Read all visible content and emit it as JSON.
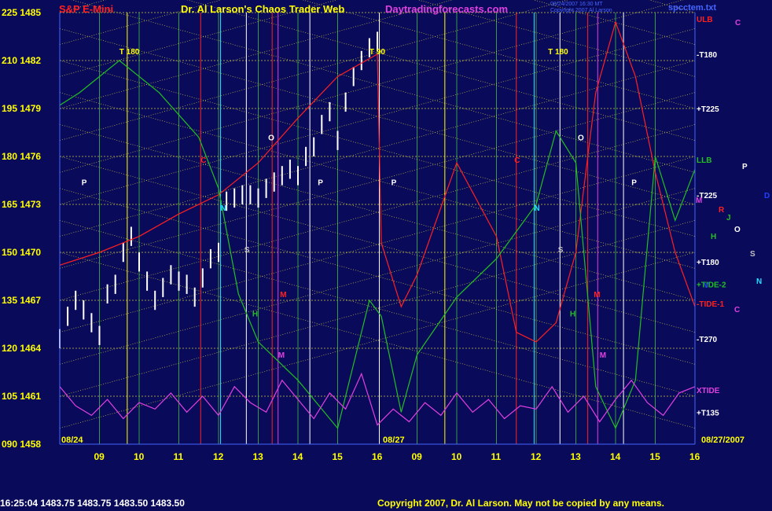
{
  "header": {
    "left_title": "S&P E-Mini",
    "center_title": "Dr. Al Larson's Chaos Trader Web",
    "site": "Daytradingforecasts.com",
    "stamp_line1": "08/24/2007 16:30 MT",
    "stamp_line2": "Copyright 2007 Al Larson",
    "file": "spcctem.txt"
  },
  "footer": {
    "quote": "16:25:04  1483.75 1483.75 1483.50 1483.50",
    "copyright": "Copyright 2007, Dr. Al Larson. May not be copied by any means."
  },
  "colors": {
    "background": "#0a0a5a",
    "axis_text": "#ffff00",
    "price_bars": "#ffffff",
    "red_line": "#ff2020",
    "green_line": "#20c020",
    "xtide": "#e040e0"
  },
  "chart_data": {
    "type": "line",
    "title": "S&P E-Mini",
    "x_labels": [
      "09",
      "10",
      "11",
      "12",
      "13",
      "14",
      "15",
      "16",
      "09",
      "10",
      "11",
      "12",
      "13",
      "14",
      "15",
      "16"
    ],
    "date_labels": [
      "08/24",
      "08/27",
      "08/27/2007"
    ],
    "y_axis_left": [
      {
        "idx": "225",
        "price": "1485",
        "v": 225
      },
      {
        "idx": "210",
        "price": "1482",
        "v": 210
      },
      {
        "idx": "195",
        "price": "1479",
        "v": 195
      },
      {
        "idx": "180",
        "price": "1476",
        "v": 180
      },
      {
        "idx": "165",
        "price": "1473",
        "v": 165
      },
      {
        "idx": "150",
        "price": "1470",
        "v": 150
      },
      {
        "idx": "135",
        "price": "1467",
        "v": 135
      },
      {
        "idx": "120",
        "price": "1464",
        "v": 120
      },
      {
        "idx": "105",
        "price": "1461",
        "v": 105
      },
      {
        "idx": "090",
        "price": "1458",
        "v": 90
      }
    ],
    "ylim": [
      90,
      225
    ],
    "xlim": [
      0,
      16
    ],
    "right_labels": [
      {
        "text": "ULB",
        "v": 223,
        "color": "#ff2020"
      },
      {
        "text": "-T180",
        "v": 212,
        "color": "#ffffff"
      },
      {
        "text": "+T225",
        "v": 195,
        "color": "#ffffff"
      },
      {
        "text": "LLB",
        "v": 179,
        "color": "#20c020"
      },
      {
        "text": "-T225",
        "v": 168,
        "color": "#ffffff"
      },
      {
        "text": "+T180",
        "v": 147,
        "color": "#ffffff"
      },
      {
        "text": "+TIDE-2",
        "v": 140,
        "color": "#20c020"
      },
      {
        "text": "-TIDE-1",
        "v": 134,
        "color": "#ff2020"
      },
      {
        "text": "-T270",
        "v": 123,
        "color": "#ffffff"
      },
      {
        "text": "XTIDE",
        "v": 107,
        "color": "#e040e0"
      },
      {
        "text": "+T135",
        "v": 100,
        "color": "#ffffff"
      }
    ],
    "legend_letters": [
      {
        "text": "C",
        "color": "#e040e0"
      },
      {
        "text": "P",
        "color": "#ffffff"
      },
      {
        "text": "D",
        "color": "#2040ff"
      },
      {
        "text": "M",
        "color": "#e040e0"
      },
      {
        "text": "R",
        "color": "#ff2020"
      },
      {
        "text": "J",
        "color": "#20c020"
      },
      {
        "text": "H",
        "color": "#20c020"
      },
      {
        "text": "O",
        "color": "#ffffff"
      },
      {
        "text": "S",
        "color": "#c0c0c0"
      },
      {
        "text": "V",
        "color": "#2040ff"
      },
      {
        "text": "N",
        "color": "#20e0ff"
      },
      {
        "text": "C",
        "color": "#e040e0"
      }
    ],
    "annotations": [
      {
        "text": "T 180",
        "x": 1.5,
        "v": 212,
        "color": "#ffff00"
      },
      {
        "text": "T 90",
        "x": 7.8,
        "v": 212,
        "color": "#ffff00"
      },
      {
        "text": "T 180",
        "x": 12.3,
        "v": 212,
        "color": "#ffff00"
      },
      {
        "text": "P",
        "x": 0.55,
        "v": 171,
        "color": "#ffffff"
      },
      {
        "text": "P",
        "x": 6.5,
        "v": 171,
        "color": "#ffffff"
      },
      {
        "text": "P",
        "x": 8.35,
        "v": 171,
        "color": "#ffffff"
      },
      {
        "text": "P",
        "x": 14.4,
        "v": 171,
        "color": "#ffffff"
      },
      {
        "text": "O",
        "x": 5.25,
        "v": 185,
        "color": "#ffffff"
      },
      {
        "text": "O",
        "x": 13.05,
        "v": 185,
        "color": "#ffffff"
      },
      {
        "text": "C",
        "x": 3.55,
        "v": 178,
        "color": "#ff2020"
      },
      {
        "text": "C",
        "x": 11.45,
        "v": 178,
        "color": "#ff2020"
      },
      {
        "text": "N",
        "x": 4.05,
        "v": 163,
        "color": "#20e0ff"
      },
      {
        "text": "N",
        "x": 11.95,
        "v": 163,
        "color": "#20e0ff"
      },
      {
        "text": "S",
        "x": 4.65,
        "v": 150,
        "color": "#c0c0c0"
      },
      {
        "text": "S",
        "x": 12.55,
        "v": 150,
        "color": "#c0c0c0"
      },
      {
        "text": "M",
        "x": 5.55,
        "v": 136,
        "color": "#ff2020"
      },
      {
        "text": "M",
        "x": 13.45,
        "v": 136,
        "color": "#ff2020"
      },
      {
        "text": "H",
        "x": 4.85,
        "v": 130,
        "color": "#20c020"
      },
      {
        "text": "H",
        "x": 12.85,
        "v": 130,
        "color": "#20c020"
      },
      {
        "text": "M",
        "x": 5.5,
        "v": 117,
        "color": "#e040e0"
      },
      {
        "text": "M",
        "x": 13.6,
        "v": 117,
        "color": "#e040e0"
      }
    ],
    "series": [
      {
        "name": "price",
        "type": "bars",
        "x": [
          0.0,
          0.2,
          0.4,
          0.6,
          0.8,
          1.0,
          1.2,
          1.4,
          1.6,
          1.8,
          2.0,
          2.2,
          2.4,
          2.6,
          2.8,
          3.0,
          3.2,
          3.4,
          3.6,
          3.8,
          4.0,
          4.2,
          4.4,
          4.6,
          4.8,
          5.0,
          5.2,
          5.4,
          5.6,
          5.8,
          6.0,
          6.2,
          6.4,
          6.6,
          6.8,
          7.0,
          7.2,
          7.4,
          7.6,
          7.8,
          8.0
        ],
        "y": [
          123,
          130,
          135,
          132,
          128,
          124,
          137,
          140,
          150,
          155,
          147,
          141,
          135,
          139,
          143,
          141,
          140,
          136,
          142,
          148,
          150,
          166,
          167,
          168,
          168,
          167,
          170,
          172,
          174,
          176,
          174,
          180,
          183,
          190,
          194,
          185,
          197,
          205,
          210,
          214,
          216
        ]
      },
      {
        "name": "red",
        "type": "line",
        "x": [
          0,
          1,
          2,
          3,
          4,
          5,
          6,
          7,
          8,
          8.1,
          8.6,
          9,
          10,
          11,
          11.5,
          12,
          12.5,
          13,
          13.5,
          14,
          14.5,
          15,
          15.5,
          16
        ],
        "y": [
          146,
          150,
          155,
          162,
          168,
          178,
          192,
          205,
          212,
          153,
          133,
          143,
          178,
          155,
          125,
          122,
          128,
          150,
          200,
          222,
          205,
          175,
          150,
          133
        ]
      },
      {
        "name": "green",
        "type": "line",
        "x": [
          0,
          0.5,
          1.5,
          2.5,
          3.5,
          4,
          4.5,
          5,
          6,
          7,
          7.8,
          8.1,
          8.6,
          9,
          10,
          11,
          12,
          12.5,
          13,
          13.5,
          14,
          14.5,
          15,
          15.5,
          16
        ],
        "y": [
          196,
          200,
          210,
          200,
          186,
          170,
          137,
          122,
          110,
          95,
          135,
          130,
          100,
          118,
          136,
          148,
          165,
          188,
          178,
          108,
          95,
          110,
          180,
          160,
          176
        ]
      },
      {
        "name": "xtide",
        "type": "line",
        "x": [
          0,
          0.4,
          0.8,
          1.2,
          1.6,
          2,
          2.4,
          2.8,
          3.2,
          3.6,
          4,
          4.4,
          4.8,
          5.2,
          5.6,
          6,
          6.4,
          6.8,
          7.2,
          7.6,
          8,
          8.4,
          8.8,
          9.2,
          9.6,
          10,
          10.4,
          10.8,
          11.2,
          11.6,
          12,
          12.4,
          12.8,
          13.2,
          13.6,
          14,
          14.4,
          14.8,
          15.2,
          15.6,
          16
        ],
        "y": [
          108,
          102,
          99,
          104,
          98,
          103,
          101,
          106,
          100,
          105,
          99,
          108,
          103,
          100,
          110,
          104,
          98,
          106,
          101,
          112,
          96,
          101,
          97,
          103,
          99,
          106,
          100,
          104,
          98,
          102,
          101,
          108,
          100,
          105,
          97,
          104,
          110,
          103,
          99,
          106,
          108
        ]
      }
    ]
  }
}
